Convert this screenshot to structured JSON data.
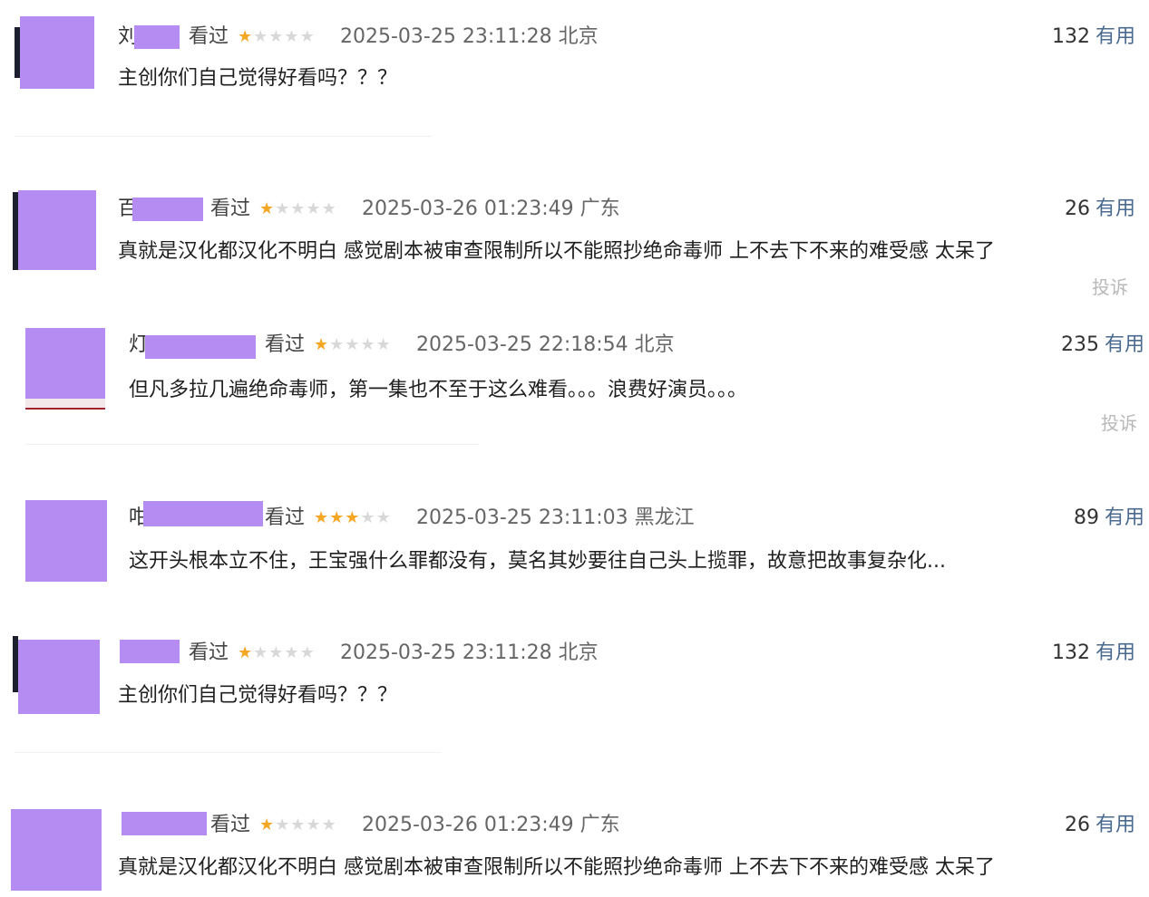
{
  "reviews": [
    {
      "name_fragment": "刘",
      "watched": "看过",
      "rating": 1,
      "time": "2025-03-25 23:11:28",
      "location": "北京",
      "useful_count": "132",
      "useful_label": "有用",
      "content": "主创你们自己觉得好看吗？？？",
      "report": ""
    },
    {
      "name_fragment": "百",
      "watched": "看过",
      "rating": 1,
      "time": "2025-03-26 01:23:49",
      "location": "广东",
      "useful_count": "26",
      "useful_label": "有用",
      "content": "真就是汉化都汉化不明白 感觉剧本被审查限制所以不能照抄绝命毒师 上不去下不来的难受感 太呆了",
      "report": "投诉"
    },
    {
      "name_fragment": "灯",
      "watched": "看过",
      "rating": 1,
      "time": "2025-03-25 22:18:54",
      "location": "北京",
      "useful_count": "235",
      "useful_label": "有用",
      "content": "但凡多拉几遍绝命毒师，第一集也不至于这么难看。。。浪费好演员。。。",
      "report": "投诉"
    },
    {
      "name_fragment": "咁",
      "watched": "看过",
      "rating": 3,
      "time": "2025-03-25 23:11:03",
      "location": "黑龙江",
      "useful_count": "89",
      "useful_label": "有用",
      "content": "这开头根本立不住，王宝强什么罪都没有，莫名其妙要往自己头上揽罪，故意把故事复杂化...",
      "report": ""
    },
    {
      "name_fragment": "",
      "watched": "看过",
      "rating": 1,
      "time": "2025-03-25 23:11:28",
      "location": "北京",
      "useful_count": "132",
      "useful_label": "有用",
      "content": "主创你们自己觉得好看吗？？？",
      "report": ""
    },
    {
      "name_fragment": "",
      "watched": "看过",
      "rating": 1,
      "time": "2025-03-26 01:23:49",
      "location": "广东",
      "useful_count": "26",
      "useful_label": "有用",
      "content": "真就是汉化都汉化不明白 感觉剧本被审查限制所以不能照抄绝命毒师 上不去下不来的难受感 太呆了",
      "report": ""
    }
  ],
  "colors": {
    "avatar_mask": "#b48cf2",
    "star_on": "#f5a623",
    "star_off": "#d8d8d8",
    "useful_label": "#4a6a8f"
  }
}
